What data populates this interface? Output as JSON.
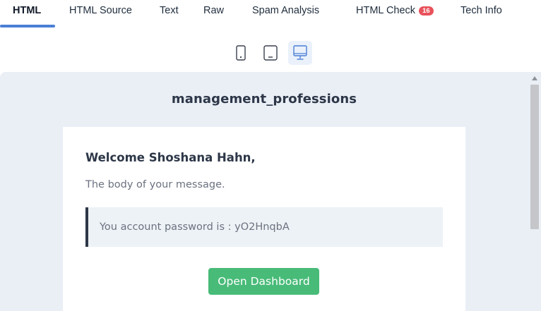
{
  "tabs": [
    {
      "label": "HTML"
    },
    {
      "label": "HTML Source"
    },
    {
      "label": "Text"
    },
    {
      "label": "Raw"
    },
    {
      "label": "Spam Analysis"
    },
    {
      "label": "HTML Check",
      "badge": "16"
    },
    {
      "label": "Tech Info"
    }
  ],
  "devices": [
    {
      "name": "mobile-icon"
    },
    {
      "name": "tablet-icon"
    },
    {
      "name": "desktop-icon"
    }
  ],
  "email": {
    "brand": "management_professions",
    "greeting": "Welcome Shoshana Hahn,",
    "body": "The body of your message.",
    "panel": "You account password is : yO2HnqbA",
    "button": "Open Dashboard"
  },
  "colors": {
    "accent": "#4a7fd6",
    "badge": "#e8525b",
    "button": "#48bb78",
    "preview_bg": "#eaeff6"
  }
}
